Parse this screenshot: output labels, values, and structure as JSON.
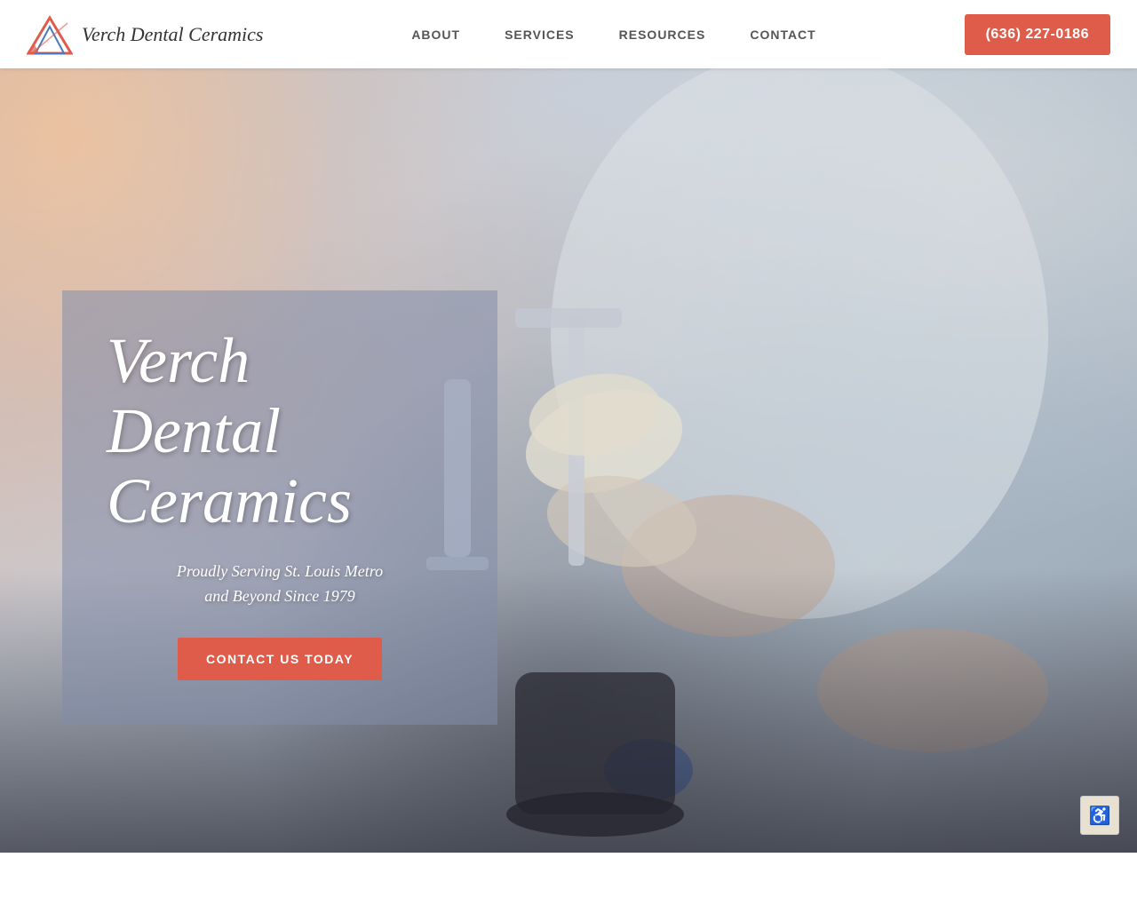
{
  "header": {
    "logo_text": "Verch Dental Ceramics",
    "phone": "(636) 227-0186",
    "nav": [
      {
        "label": "ABOUT",
        "href": "#about"
      },
      {
        "label": "SERVICES",
        "href": "#services"
      },
      {
        "label": "RESOURCES",
        "href": "#resources"
      },
      {
        "label": "CONTACT",
        "href": "#contact"
      }
    ]
  },
  "hero": {
    "title": "Verch\nDental\nCeramics",
    "subtitle": "Proudly Serving St. Louis Metro\nand Beyond Since 1979",
    "cta_label": "CONTACT US TODAY"
  },
  "accessibility": {
    "icon_label": "♿",
    "aria_label": "Accessibility options"
  }
}
